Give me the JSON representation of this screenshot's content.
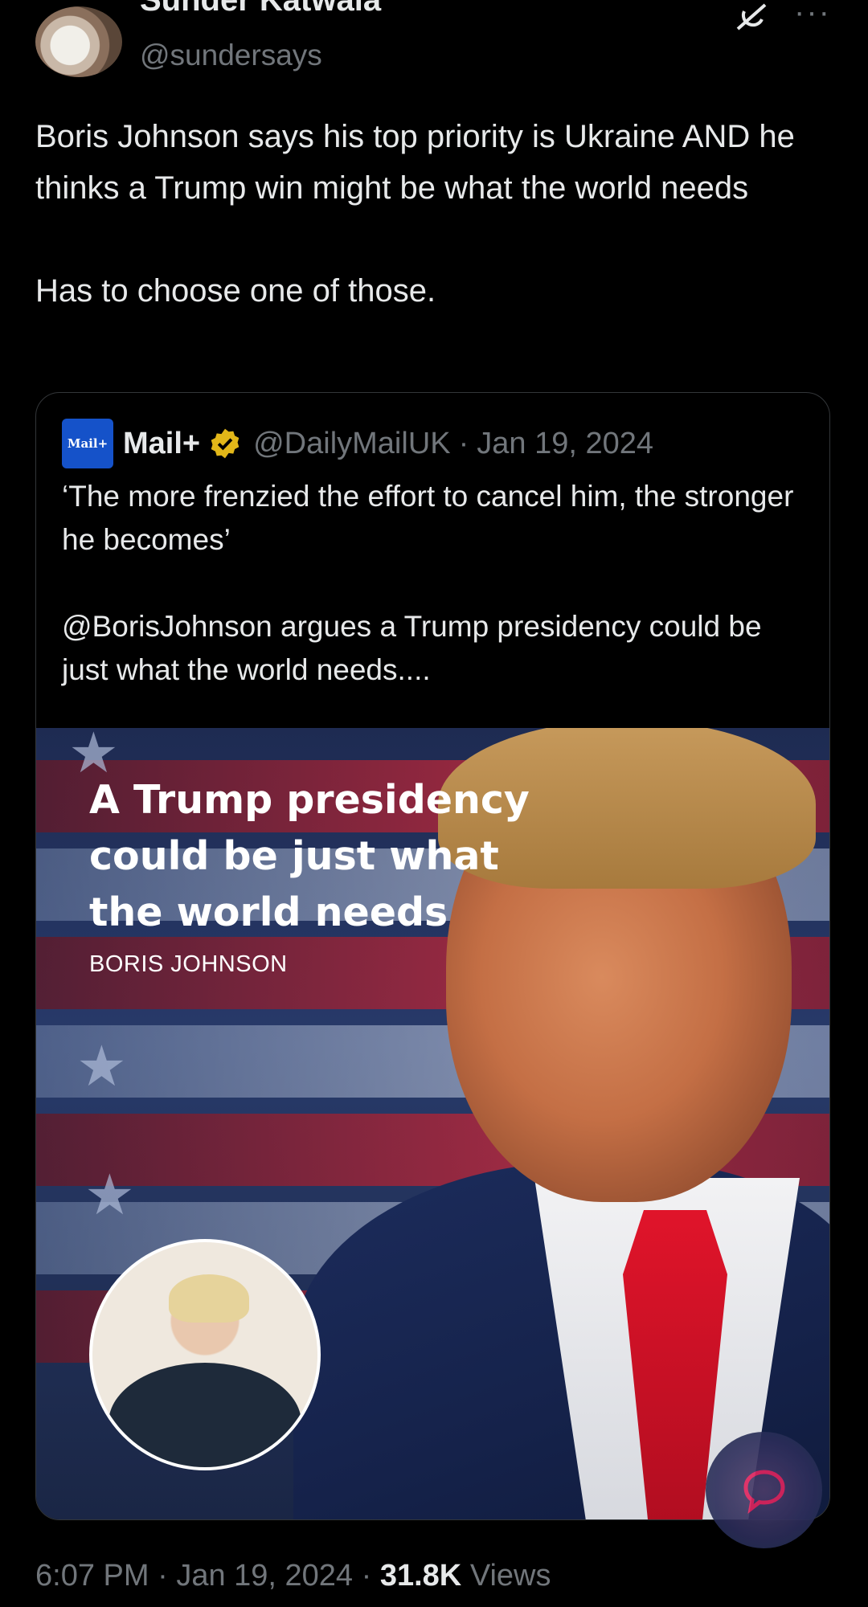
{
  "author": {
    "display_name": "Sunder Katwala",
    "handle": "@sundersays"
  },
  "tweet": {
    "text_line1": "Boris Johnson says his top priority is Ukraine AND he thinks a Trump win might be what the world needs",
    "text_line2": "Has to choose one of those."
  },
  "quoted": {
    "logo_text": "Mail+",
    "name": "Mail+",
    "handle": "@DailyMailUK",
    "date": "Jan 19, 2024",
    "text_line1": "‘The more frenzied the effort to cancel him, the stronger he becomes’",
    "text_line2": "@BorisJohnson argues a Trump presidency could be just what the world needs....",
    "media_headline": "A Trump presidency could be just what the world needs",
    "media_byline": "BORIS JOHNSON"
  },
  "footer": {
    "time": "6:07 PM",
    "date": "Jan 19, 2024",
    "views_count": "31.8K",
    "views_label": "Views"
  },
  "colors": {
    "background": "#000000",
    "text": "#e7e9ea",
    "secondary": "#71767b",
    "verified_gold": "#e2b719",
    "mail_blue": "#1552c9"
  },
  "icons": [
    "grok-icon",
    "more-icon",
    "verified-badge-icon",
    "reply-fab-icon"
  ]
}
